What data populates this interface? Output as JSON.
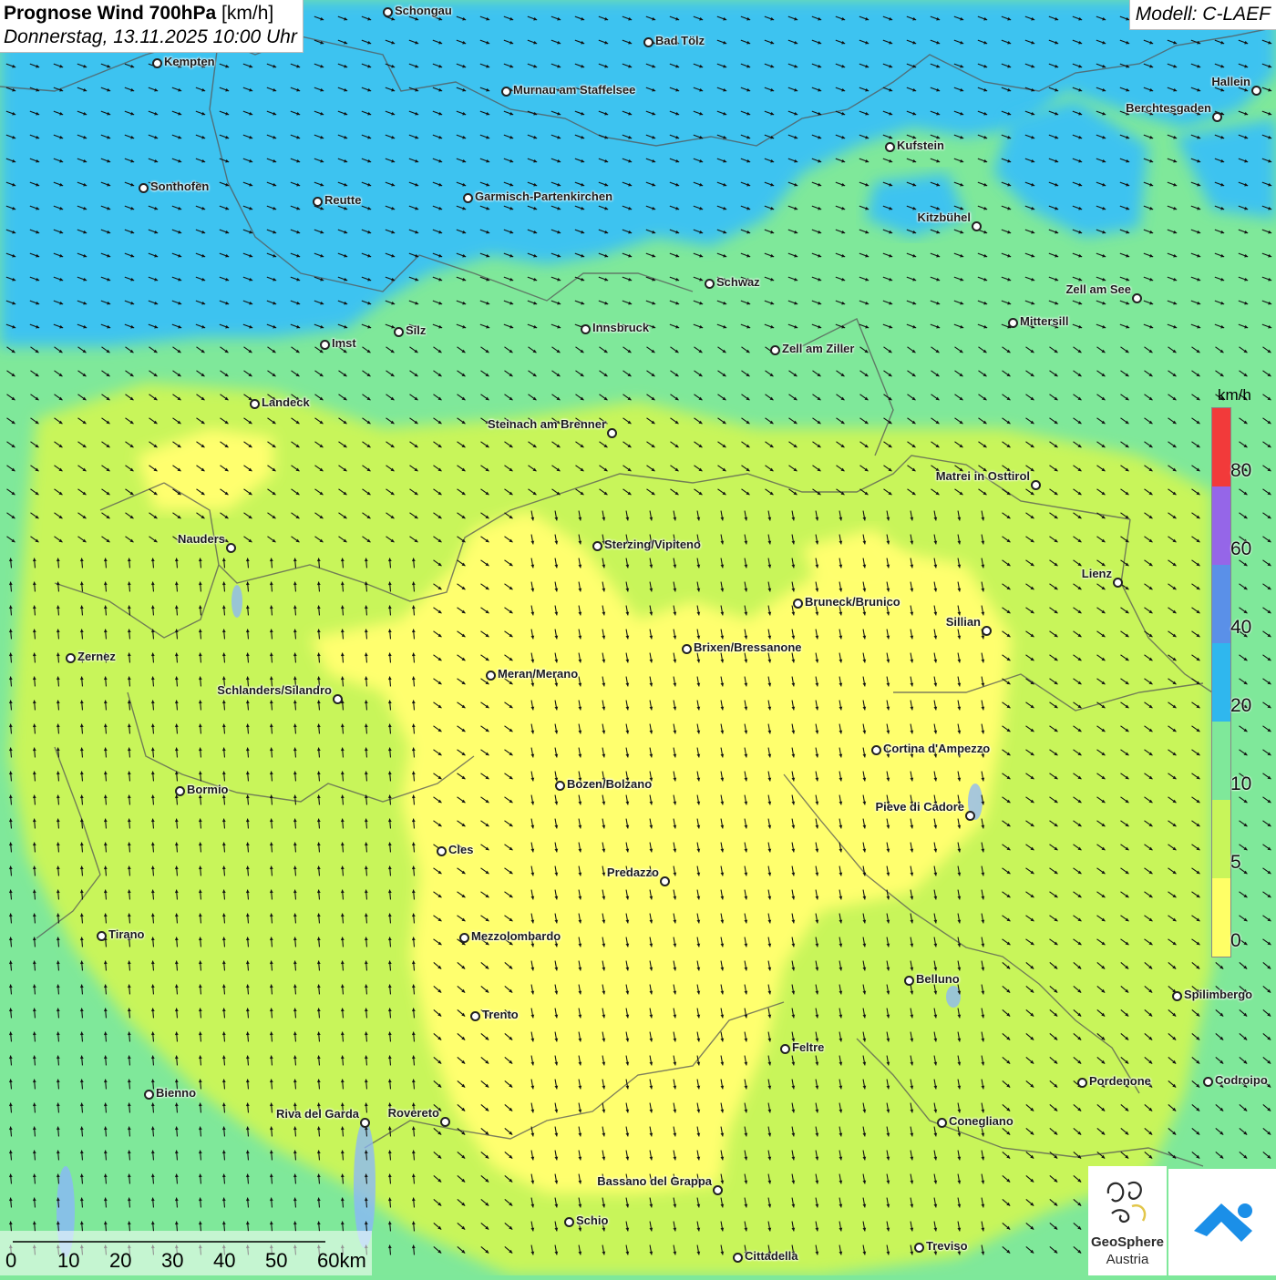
{
  "header": {
    "title_bold": "Prognose Wind 700hPa",
    "title_unit": "[km/h]",
    "datetime": "Donnerstag, 13.11.2025 10:00 Uhr",
    "model": "Modell: C-LAEF"
  },
  "legend": {
    "unit": "km/h",
    "stops": [
      {
        "label": "0",
        "color": "#ffff66"
      },
      {
        "label": "5",
        "color": "#c8f55a"
      },
      {
        "label": "10",
        "color": "#7fe89a"
      },
      {
        "label": "20",
        "color": "#2fb7ee"
      },
      {
        "label": "40",
        "color": "#5a90e8"
      },
      {
        "label": "60",
        "color": "#9566e8"
      },
      {
        "label": "80",
        "color": "#f23a3a"
      }
    ]
  },
  "scale_bar": {
    "labels": [
      "0",
      "10",
      "20",
      "30",
      "40",
      "50",
      "60km"
    ]
  },
  "logo": {
    "line1": "GeoSphere",
    "line2": "Austria"
  },
  "cities": [
    {
      "name": "Schongau"
    },
    {
      "name": "Bad Tölz"
    },
    {
      "name": "Kempten"
    },
    {
      "name": "Murnau am Staffelsee"
    },
    {
      "name": "Hallein"
    },
    {
      "name": "Berchtesgaden"
    },
    {
      "name": "Kufstein"
    },
    {
      "name": "Sonthofen"
    },
    {
      "name": "Reutte"
    },
    {
      "name": "Garmisch-Partenkirchen"
    },
    {
      "name": "Kitzbühel"
    },
    {
      "name": "Schwaz"
    },
    {
      "name": "Zell am See"
    },
    {
      "name": "Mittersill"
    },
    {
      "name": "Silz"
    },
    {
      "name": "Innsbruck"
    },
    {
      "name": "Imst"
    },
    {
      "name": "Zell am Ziller"
    },
    {
      "name": "Landeck"
    },
    {
      "name": "Steinach am Brenner"
    },
    {
      "name": "Matrei in Osttirol"
    },
    {
      "name": "Nauders"
    },
    {
      "name": "Sterzing/Vipiteno"
    },
    {
      "name": "Lienz"
    },
    {
      "name": "Bruneck/Brunico"
    },
    {
      "name": "Sillian"
    },
    {
      "name": "Zernez"
    },
    {
      "name": "Brixen/Bressanone"
    },
    {
      "name": "Meran/Merano"
    },
    {
      "name": "Schlanders/Silandro"
    },
    {
      "name": "Cortina d'Ampezzo"
    },
    {
      "name": "Bozen/Bolzano"
    },
    {
      "name": "Bormio"
    },
    {
      "name": "Pieve di Cadore"
    },
    {
      "name": "Cles"
    },
    {
      "name": "Predazzo"
    },
    {
      "name": "Tirano"
    },
    {
      "name": "Mezzolombardo"
    },
    {
      "name": "Belluno"
    },
    {
      "name": "Spilimbergo"
    },
    {
      "name": "Trento"
    },
    {
      "name": "Feltre"
    },
    {
      "name": "Pordenone"
    },
    {
      "name": "Codroipo"
    },
    {
      "name": "Bienno"
    },
    {
      "name": "Riva del Garda"
    },
    {
      "name": "Rovereto"
    },
    {
      "name": "Conegliano"
    },
    {
      "name": "Bassano del Grappa"
    },
    {
      "name": "Schio"
    },
    {
      "name": "Treviso"
    },
    {
      "name": "Cittadella"
    }
  ]
}
